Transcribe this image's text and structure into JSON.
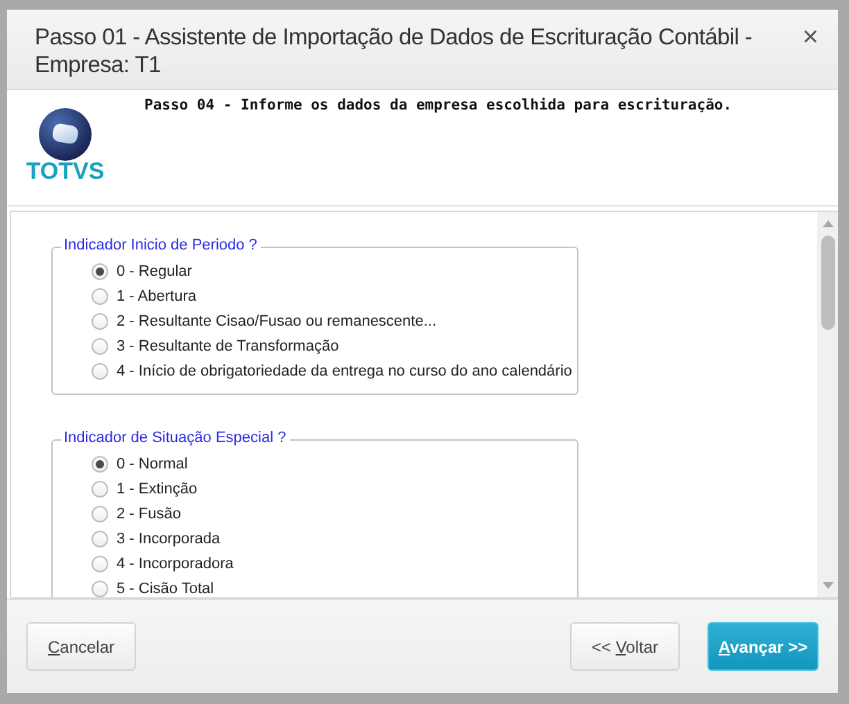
{
  "window": {
    "title": "Passo 01 - Assistente de Importação de Dados de Escrituração Contábil - Empresa: T1",
    "close": "×"
  },
  "header": {
    "logo_text": "TOTVS",
    "step": "Passo 04 - Informe os dados da empresa escolhida para escrituração."
  },
  "groups": [
    {
      "legend": "Indicador Inicio de Periodo ?",
      "options": [
        {
          "label": "0 - Regular",
          "selected": true
        },
        {
          "label": "1 - Abertura",
          "selected": false
        },
        {
          "label": "2 - Resultante Cisao/Fusao ou remanescente...",
          "selected": false
        },
        {
          "label": "3 - Resultante de Transformação",
          "selected": false
        },
        {
          "label": "4 - Início de obrigatoriedade da entrega no curso do ano calendário",
          "selected": false
        }
      ]
    },
    {
      "legend": "Indicador de Situação Especial ?",
      "options": [
        {
          "label": "0 - Normal",
          "selected": true
        },
        {
          "label": "1 - Extinção",
          "selected": false
        },
        {
          "label": "2 - Fusão",
          "selected": false
        },
        {
          "label": "3 - Incorporada",
          "selected": false
        },
        {
          "label": "4 - Incorporadora",
          "selected": false
        },
        {
          "label": "5 - Cisão Total",
          "selected": false
        }
      ]
    }
  ],
  "buttons": [
    {
      "kind": "secondary",
      "key": "C",
      "after": "ancelar"
    },
    {
      "kind": "secondary",
      "before": "<< ",
      "key": "V",
      "after": "oltar"
    },
    {
      "kind": "primary",
      "key": "A",
      "after": "vançar >>"
    }
  ]
}
